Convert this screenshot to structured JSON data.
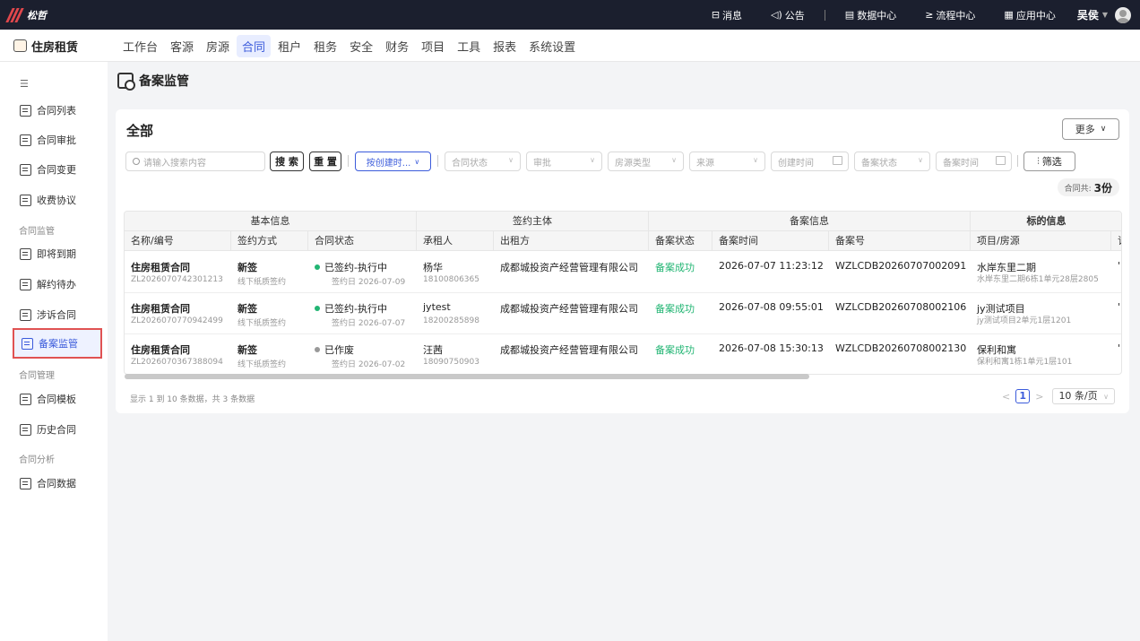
{
  "topbar": {
    "brand": "松哲",
    "items": [
      {
        "icon": "message-icon",
        "glyph": "⊟",
        "label": "消息"
      },
      {
        "icon": "announcement-icon",
        "glyph": "◁)",
        "label": "公告"
      },
      {
        "icon": "data-center-icon",
        "glyph": "▤",
        "label": "数据中心"
      },
      {
        "icon": "process-center-icon",
        "glyph": "≥",
        "label": "流程中心"
      },
      {
        "icon": "app-center-icon",
        "glyph": "▦",
        "label": "应用中心"
      }
    ],
    "user": "吴侯"
  },
  "header": {
    "app_title": "住房租赁",
    "nav": [
      "工作台",
      "客源",
      "房源",
      "合同",
      "租户",
      "租务",
      "安全",
      "财务",
      "项目",
      "工具",
      "报表",
      "系统设置"
    ],
    "active_nav": "合同"
  },
  "sidebar": {
    "items": [
      {
        "label": "合同列表"
      },
      {
        "label": "合同审批"
      },
      {
        "label": "合同变更"
      },
      {
        "label": "收费协议"
      },
      {
        "label": "即将到期"
      },
      {
        "label": "解约待办"
      },
      {
        "label": "涉诉合同"
      },
      {
        "label": "备案监管"
      },
      {
        "label": "合同模板"
      },
      {
        "label": "历史合同"
      },
      {
        "label": "合同数据"
      }
    ],
    "groups": [
      "合同监管",
      "合同管理",
      "合同分析"
    ],
    "active": "备案监管"
  },
  "page": {
    "title": "备案监管",
    "card_title": "全部",
    "more_label": "更多"
  },
  "filters": {
    "search_placeholder": "请输入搜索内容",
    "search_label": "搜 索",
    "reset_label": "重 置",
    "sort_label": "按创建时...",
    "contract_status": "合同状态",
    "approval": "审批",
    "room_type": "房源类型",
    "source": "来源",
    "create_time": "创建时间",
    "filing_status": "备案状态",
    "filing_time": "备案时间",
    "filter_label": "筛选"
  },
  "summary": {
    "count_label": "合同共:",
    "count_value": "3份"
  },
  "table": {
    "groups": [
      "基本信息",
      "签约主体",
      "备案信息",
      "标的信息"
    ],
    "columns": [
      "名称/编号",
      "签约方式",
      "合同状态",
      "承租人",
      "出租方",
      "备案状态",
      "备案时间",
      "备案号",
      "项目/房源",
      "订"
    ],
    "rows": [
      {
        "name": "住房租赁合同",
        "code": "ZL2026070742301213",
        "sign_type": "新签",
        "sign_method": "线下纸质签约",
        "status": "已签约-执行中",
        "status_color": "#22b573",
        "sign_date": "签约日 2026-07-09",
        "tenant": "杨华",
        "tenant_phone": "18100806365",
        "lessor": "成都城投资产经营管理有限公司",
        "filing_status": "备案成功",
        "filing_time": "2026-07-07 11:23:12",
        "filing_no": "WZLCDB20260707002091",
        "project": "水岸东里二期",
        "room": "水岸东里二期6栋1单元28层2805",
        "more": "'"
      },
      {
        "name": "住房租赁合同",
        "code": "ZL2026070770942499",
        "sign_type": "新签",
        "sign_method": "线下纸质签约",
        "status": "已签约-执行中",
        "status_color": "#22b573",
        "sign_date": "签约日 2026-07-07",
        "tenant": "jytest",
        "tenant_phone": "18200285898",
        "lessor": "成都城投资产经营管理有限公司",
        "filing_status": "备案成功",
        "filing_time": "2026-07-08 09:55:01",
        "filing_no": "WZLCDB20260708002106",
        "project": "jy测试项目",
        "room": "jy测试项目2单元1层1201",
        "more": "'"
      },
      {
        "name": "住房租赁合同",
        "code": "ZL2026070367388094",
        "sign_type": "新签",
        "sign_method": "线下纸质签约",
        "status": "已作废",
        "status_color": "#999999",
        "sign_date": "签约日 2026-07-02",
        "tenant": "汪茜",
        "tenant_phone": "18090750903",
        "lessor": "成都城投资产经营管理有限公司",
        "filing_status": "备案成功",
        "filing_time": "2026-07-08 15:30:13",
        "filing_no": "WZLCDB20260708002130",
        "project": "保利和寓",
        "room": "保利和寓1栋1单元1层101",
        "more": "'"
      }
    ]
  },
  "pagination": {
    "info": "显示 1 到 10 条数据，共 3 条数据",
    "prev": "<",
    "current": "1",
    "next": ">",
    "page_size": "10 条/页"
  }
}
